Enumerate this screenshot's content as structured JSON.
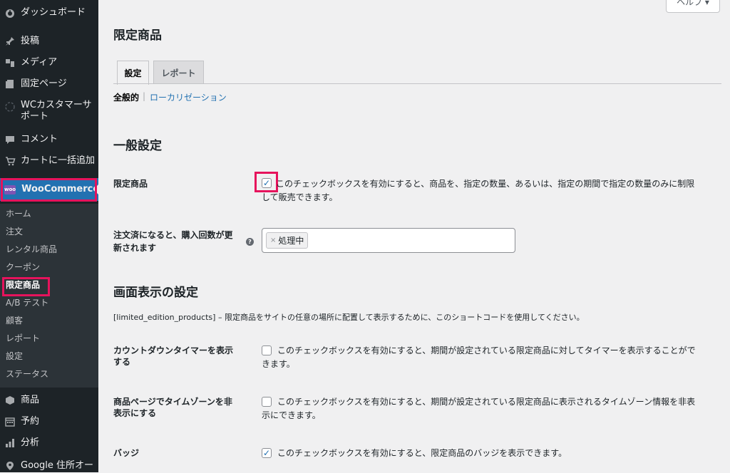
{
  "sidebar": {
    "top_items": [
      {
        "icon": "dashboard-icon",
        "label": "ダッシュボード"
      },
      {
        "icon": "pin-icon",
        "label": "投稿"
      },
      {
        "icon": "media-icon",
        "label": "メディア"
      },
      {
        "icon": "page-icon",
        "label": "固定ページ"
      },
      {
        "icon": "wc-customer-icon",
        "label": "WCカスタマーサポート"
      },
      {
        "icon": "comment-icon",
        "label": "コメント"
      },
      {
        "icon": "cart-icon",
        "label": "カートに一括追加"
      }
    ],
    "woocommerce": {
      "logo_text": "woo",
      "label": "WooCommerce"
    },
    "submenu": [
      "ホーム",
      "注文",
      "レンタル商品",
      "クーポン",
      "限定商品",
      "A/B テスト",
      "顧客",
      "レポート",
      "設定",
      "ステータス"
    ],
    "bottom_items": [
      {
        "icon": "product-icon",
        "label": "商品"
      },
      {
        "icon": "calendar-icon",
        "label": "予約"
      },
      {
        "icon": "analytics-icon",
        "label": "分析"
      },
      {
        "icon": "location-icon",
        "label": "Google 住所オー"
      }
    ]
  },
  "help_label": "ヘルプ ▾",
  "page_title": "限定商品",
  "tabs": [
    "設定",
    "レポート"
  ],
  "subsub": {
    "current": "全般的",
    "separator": "|",
    "link": "ローカリゼーション"
  },
  "general": {
    "heading": "一般設定",
    "limited_label": "限定商品",
    "limited_desc_1": "このチェックボックスを有効にすると、商品を、指定の数量、あるいは、指定の期間で指定の数量のみに制限",
    "limited_desc_2": "して販売できます。",
    "limited_checked": true,
    "order_label_1": "注文済になると、購入回数が更",
    "order_label_2": "新されます",
    "help_tip": "?",
    "order_chip_remove": "×",
    "order_chip": "処理中"
  },
  "display": {
    "heading": "画面表示の設定",
    "shortcode_desc": "[limited_edition_products] – 限定商品をサイトの任意の場所に配置して表示するために、このショートコードを使用してください。",
    "countdown_label_1": "カウントダウンタイマーを表示",
    "countdown_label_2": "する",
    "countdown_desc_1": "このチェックボックスを有効にすると、期間が設定されている限定商品に対してタイマーを表示することがで",
    "countdown_desc_2": "きます。",
    "countdown_checked": false,
    "timezone_label_1": "商品ページでタイムゾーンを非",
    "timezone_label_2": "表示にする",
    "timezone_desc_1": "このチェックボックスを有効にすると、期間が設定されている限定商品に表示されるタイムゾーン情報を非表",
    "timezone_desc_2": "示にできます。",
    "timezone_checked": false,
    "badge_label": "バッジ",
    "badge_desc": "このチェックボックスを有効にすると、限定商品のバッジを表示できます。",
    "badge_checked": true,
    "check_glyph": "✓"
  }
}
